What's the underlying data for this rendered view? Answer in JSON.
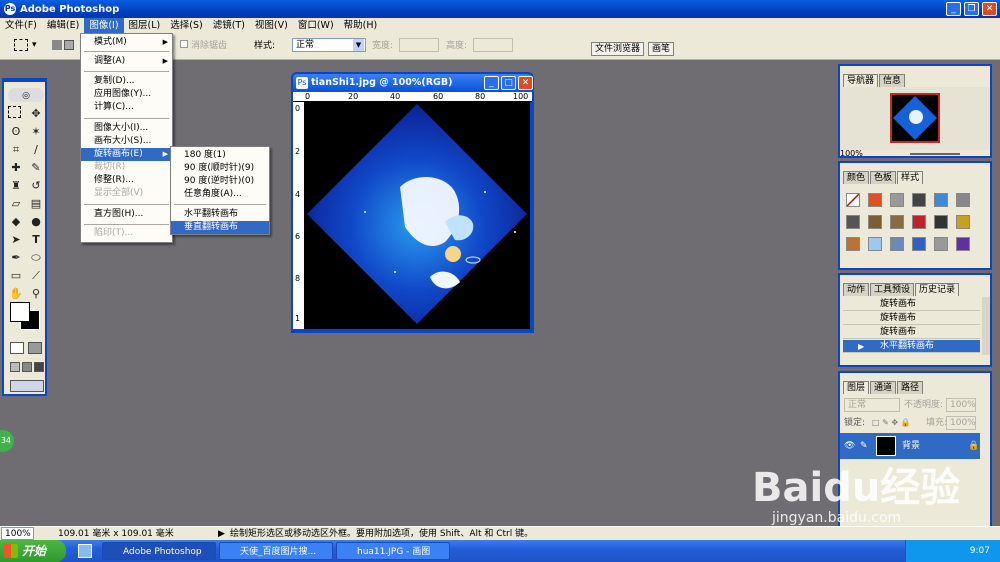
{
  "app": {
    "title": "Adobe Photoshop"
  },
  "menubar": {
    "items": [
      "文件(F)",
      "编辑(E)",
      "图像(I)",
      "图层(L)",
      "选择(S)",
      "滤镜(T)",
      "视图(V)",
      "窗口(W)",
      "帮助(H)"
    ],
    "active_index": 2
  },
  "options": {
    "antialias_label": "消除锯齿",
    "style_label": "样式:",
    "style_value": "正常",
    "width_label": "宽度:",
    "height_label": "高度:",
    "tab_file_browser": "文件浏览器",
    "tab_brushes": "画笔"
  },
  "image_menu": {
    "items": [
      "模式(M)",
      "调整(A)",
      "复制(D)...",
      "应用图像(Y)...",
      "计算(C)...",
      "图像大小(I)...",
      "画布大小(S)...",
      "旋转画布(E)",
      "裁切(R)",
      "修整(R)...",
      "显示全部(V)",
      "直方图(H)...",
      "陷印(T)..."
    ]
  },
  "rotate_submenu": {
    "items": [
      "180 度(1)",
      "90 度(顺时针)(9)",
      "90 度(逆时针)(0)",
      "任意角度(A)...",
      "水平翻转画布",
      "垂直翻转画布"
    ]
  },
  "document": {
    "title": "tianShi1.jpg @ 100%(RGB)",
    "ruler_h": [
      "0",
      "20",
      "40",
      "60",
      "80",
      "100"
    ],
    "ruler_v": [
      "0",
      "2",
      "4",
      "6",
      "8",
      "1"
    ]
  },
  "navigator": {
    "tabs": [
      "导航器",
      "信息"
    ],
    "zoom": "100%"
  },
  "styles_panel": {
    "tabs": [
      "颜色",
      "色板",
      "样式"
    ]
  },
  "history": {
    "tabs": [
      "动作",
      "工具预设",
      "历史记录"
    ],
    "rows": [
      "旋转画布",
      "旋转画布",
      "旋转画布",
      "水平翻转画布"
    ]
  },
  "layers": {
    "tabs": [
      "图层",
      "通道",
      "路径"
    ],
    "blend_mode": "正常",
    "opacity_label": "不透明度:",
    "opacity": "100%",
    "lock_label": "锁定:",
    "fill_label": "填充:",
    "fill": "100%",
    "layer_name": "背景"
  },
  "status": {
    "zoom": "100%",
    "doc_size": "109.01 毫米 x 109.01 毫米",
    "hint": "绘制矩形选区或移动选区外框。要用附加选项，使用 Shift、Alt 和 Ctrl 键。"
  },
  "taskbar": {
    "start": "开始",
    "items": [
      "Adobe Photoshop",
      "天使_百度图片搜...",
      "hua11.JPG - 画图"
    ],
    "clock": "9:07"
  },
  "watermark": {
    "main": "Baidu经验",
    "sub": "jingyan.baidu.com"
  },
  "badge": "34",
  "colors": {
    "xp_blue": "#0a46c4",
    "menu_highlight": "#316ac5",
    "workspace": "#6f6d72"
  }
}
